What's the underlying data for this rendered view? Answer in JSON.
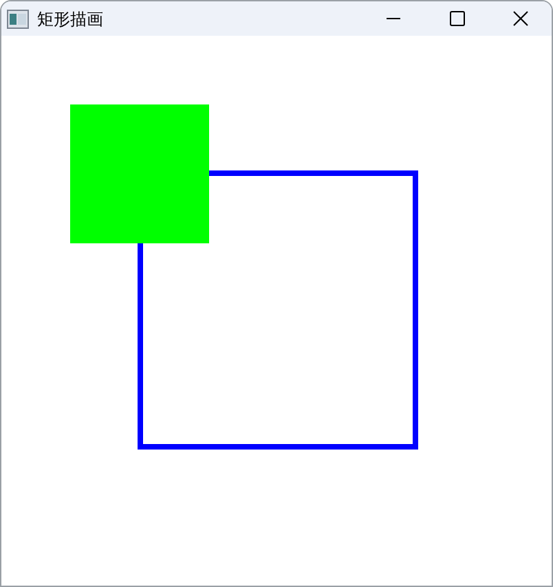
{
  "window": {
    "title": "矩形描画"
  },
  "shapes": [
    {
      "kind": "outline",
      "color": "#0000ff"
    },
    {
      "kind": "filled",
      "color": "#00ff00"
    }
  ]
}
